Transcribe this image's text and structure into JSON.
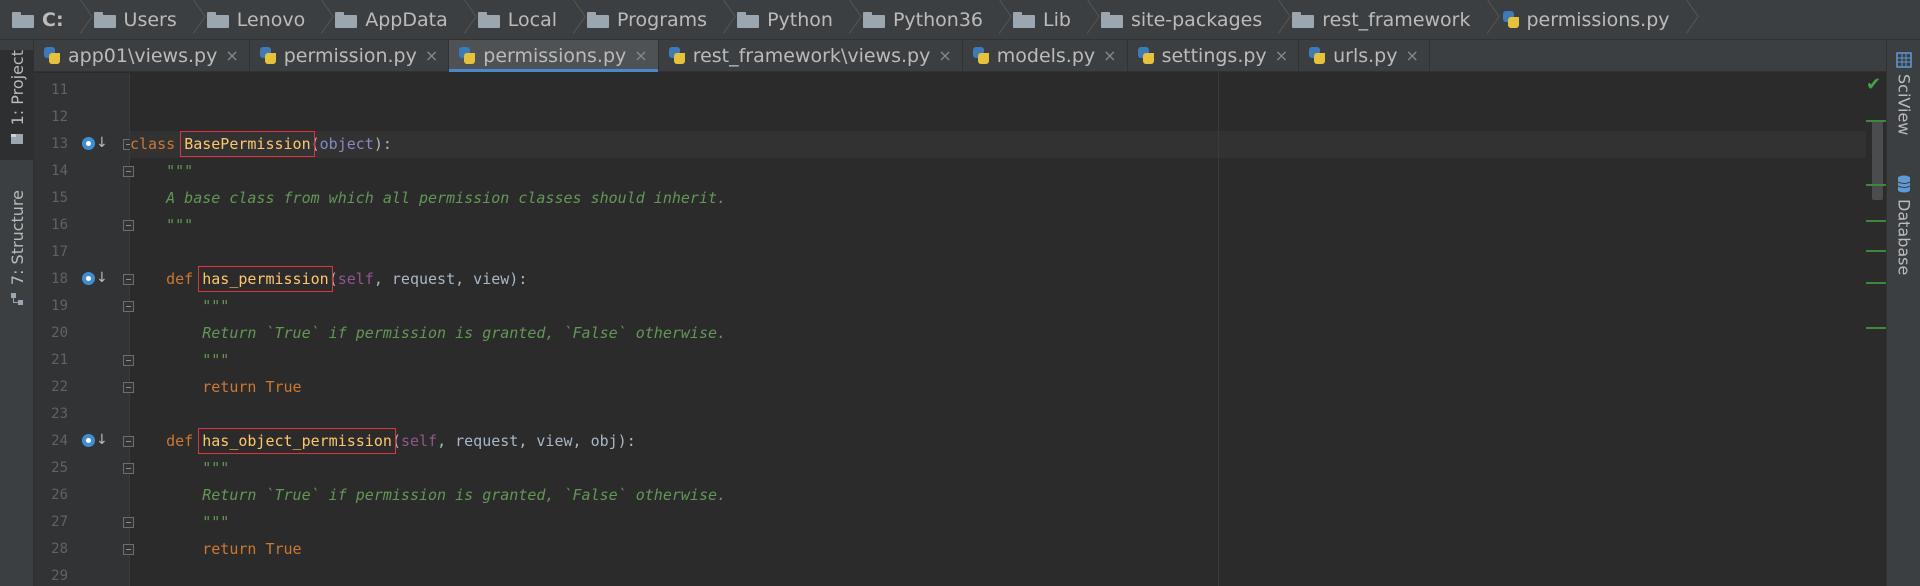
{
  "breadcrumb": {
    "items": [
      {
        "label": "C:",
        "kind": "drive"
      },
      {
        "label": "Users",
        "kind": "folder"
      },
      {
        "label": "Lenovo",
        "kind": "folder"
      },
      {
        "label": "AppData",
        "kind": "folder"
      },
      {
        "label": "Local",
        "kind": "folder"
      },
      {
        "label": "Programs",
        "kind": "folder"
      },
      {
        "label": "Python",
        "kind": "folder"
      },
      {
        "label": "Python36",
        "kind": "folder"
      },
      {
        "label": "Lib",
        "kind": "folder"
      },
      {
        "label": "site-packages",
        "kind": "folder"
      },
      {
        "label": "rest_framework",
        "kind": "folder"
      },
      {
        "label": "permissions.py",
        "kind": "python-file"
      }
    ]
  },
  "tabs": [
    {
      "label": "app01\\views.py",
      "active": false
    },
    {
      "label": "permission.py",
      "active": false
    },
    {
      "label": "permissions.py",
      "active": true
    },
    {
      "label": "rest_framework\\views.py",
      "active": false
    },
    {
      "label": "models.py",
      "active": false
    },
    {
      "label": "settings.py",
      "active": false
    },
    {
      "label": "urls.py",
      "active": false
    }
  ],
  "tab_close_glyph": "×",
  "left_toolwindows": {
    "project": "1: Project",
    "structure": "7: Structure"
  },
  "right_toolwindows": {
    "sciview": "SciView",
    "database": "Database"
  },
  "editor": {
    "lines": [
      {
        "num": "11",
        "text": ""
      },
      {
        "num": "12",
        "text": ""
      },
      {
        "num": "13",
        "text": "class BasePermission(object):"
      },
      {
        "num": "14",
        "text": "    \"\"\""
      },
      {
        "num": "15",
        "text": "    A base class from which all permission classes should inherit."
      },
      {
        "num": "16",
        "text": "    \"\"\""
      },
      {
        "num": "17",
        "text": ""
      },
      {
        "num": "18",
        "text": "    def has_permission(self, request, view):"
      },
      {
        "num": "19",
        "text": "        \"\"\""
      },
      {
        "num": "20",
        "text": "        Return `True` if permission is granted, `False` otherwise."
      },
      {
        "num": "21",
        "text": "        \"\"\""
      },
      {
        "num": "22",
        "text": "        return True"
      },
      {
        "num": "23",
        "text": ""
      },
      {
        "num": "24",
        "text": "    def has_object_permission(self, request, view, obj):"
      },
      {
        "num": "25",
        "text": "        \"\"\""
      },
      {
        "num": "26",
        "text": "        Return `True` if permission is granted, `False` otherwise."
      },
      {
        "num": "27",
        "text": "        \"\"\""
      },
      {
        "num": "28",
        "text": "        return True"
      },
      {
        "num": "29",
        "text": ""
      }
    ]
  },
  "highlights": [
    "BasePermission",
    "has_permission",
    "has_object_permission"
  ],
  "colors": {
    "keyword": "#cc7832",
    "function": "#ffc66d",
    "docstring": "#629755",
    "self": "#94558d",
    "highlight_box": "#e0333d",
    "active_tab_underline": "#4a88c7"
  },
  "icons": {
    "folder": "folder-icon",
    "python_file": "python-file-icon",
    "override_marker": "override-method-icon",
    "status_ok": "check-icon"
  }
}
